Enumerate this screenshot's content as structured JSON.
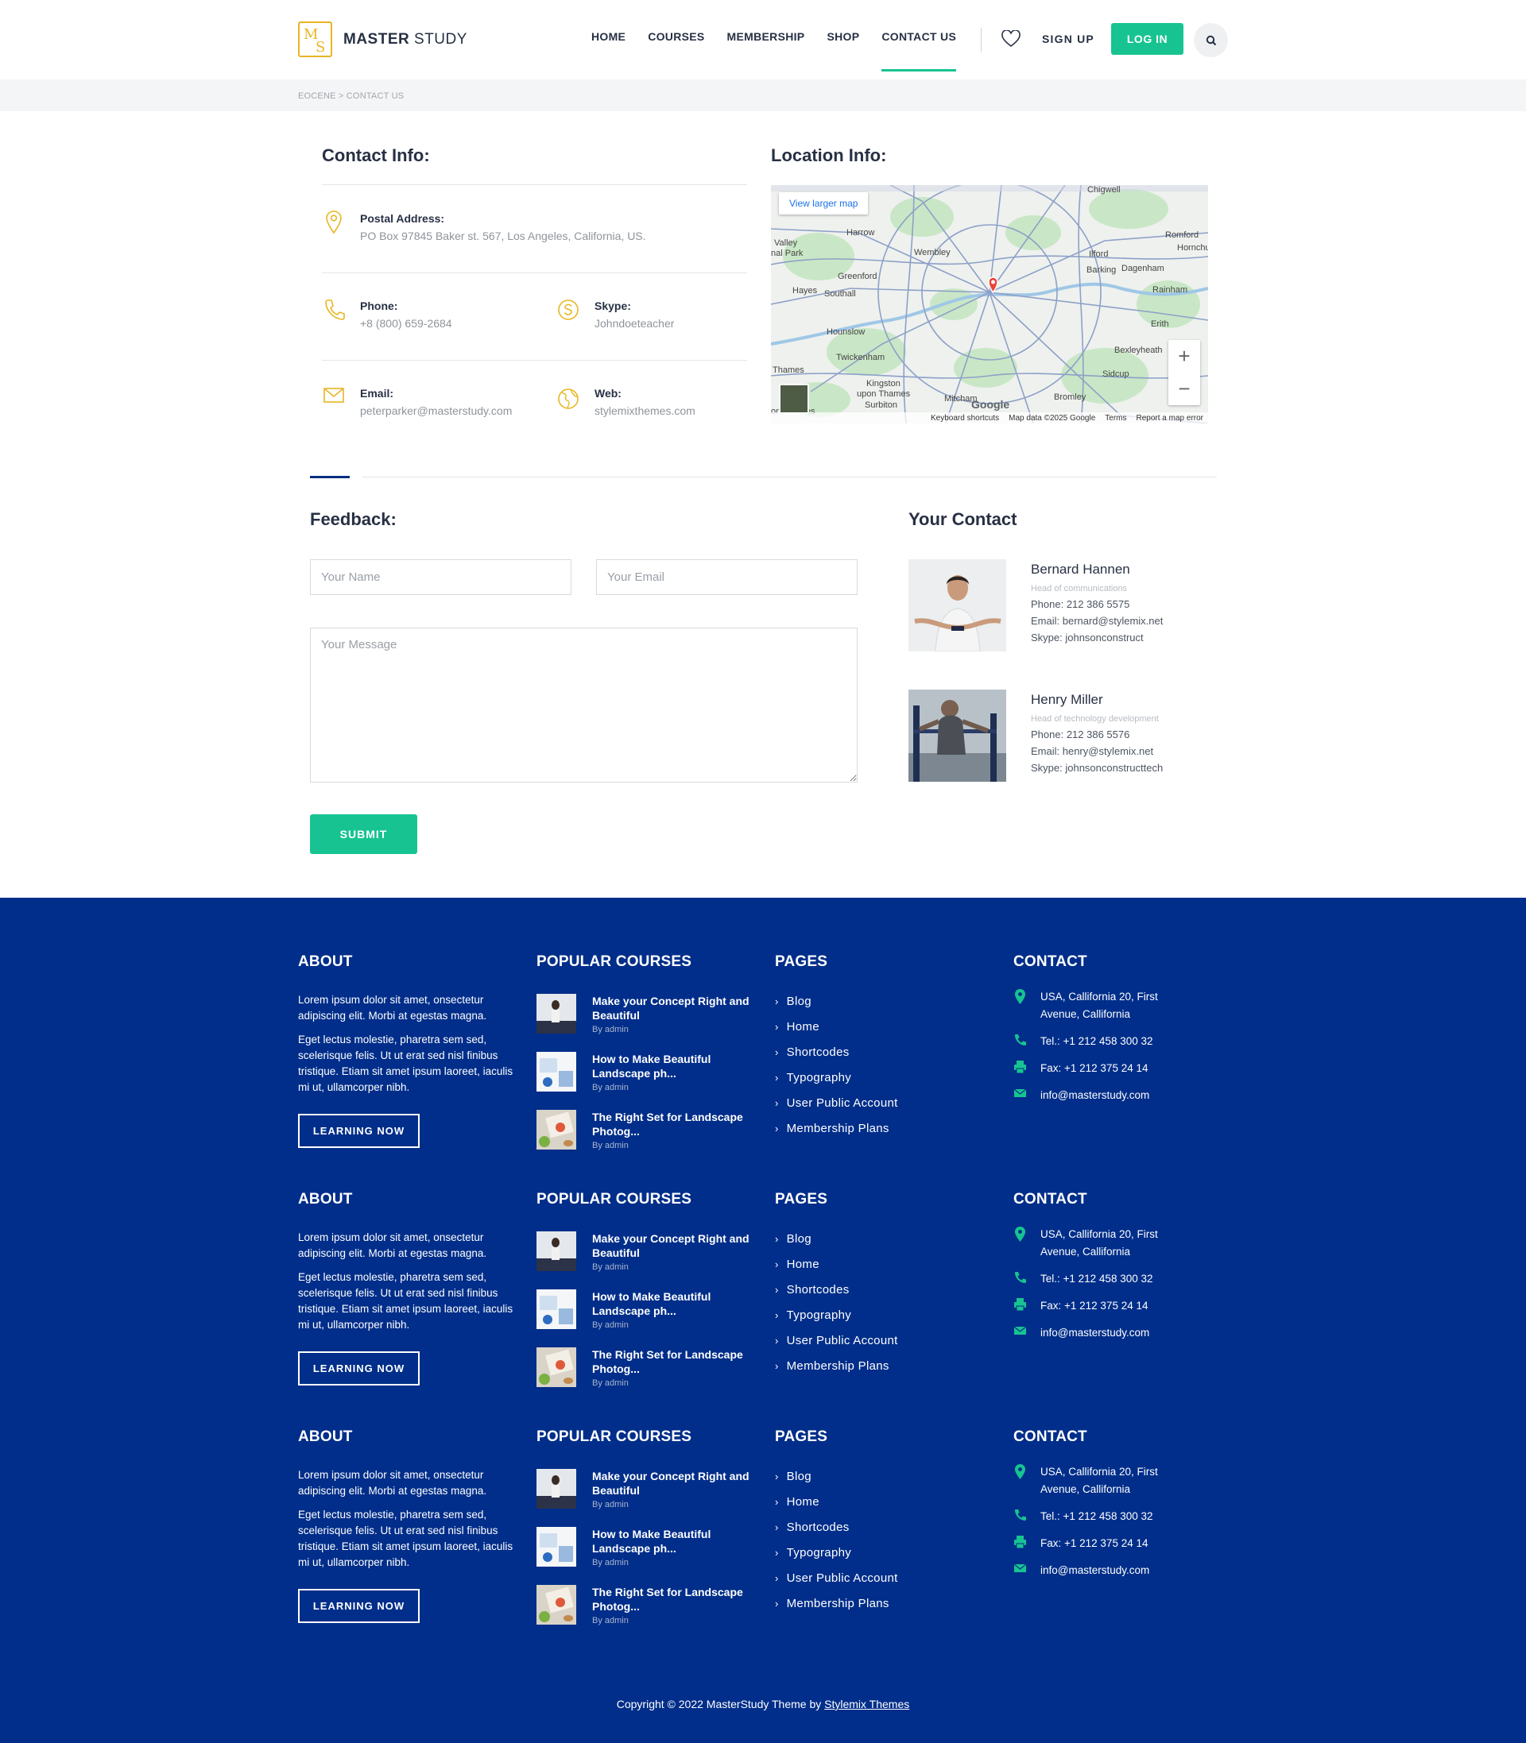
{
  "header": {
    "logo_strong": "MASTER",
    "logo_light": "STUDY",
    "logo_badge_m": "M",
    "logo_badge_s": "S",
    "nav": [
      "HOME",
      "COURSES",
      "MEMBERSHIP",
      "SHOP",
      "CONTACT US"
    ],
    "active_nav": "CONTACT US",
    "signup": "SIGN UP",
    "login": "LOG IN"
  },
  "breadcrumb": "EOCENE > CONTACT US",
  "contact_info": {
    "title": "Contact Info:",
    "postal_label": "Postal Address:",
    "postal_value": "PO Box 97845 Baker st. 567, Los Angeles, California, US.",
    "phone_label": "Phone:",
    "phone_value": "+8 (800) 659-2684",
    "skype_label": "Skype:",
    "skype_value": "Johndoeteacher",
    "email_label": "Email:",
    "email_value": "peterparker@masterstudy.com",
    "web_label": "Web:",
    "web_value": "stylemixthemes.com"
  },
  "location": {
    "title": "Location Info:",
    "view_larger": "View larger map",
    "map_footer": [
      "Keyboard shortcuts",
      "Map data ©2025 Google",
      "Terms",
      "Report a map error"
    ],
    "google": "Google",
    "places": [
      "Chigwell",
      "Harrow",
      "Romford",
      "Wembley",
      "Hornchurch",
      "Ilford",
      "Greenford",
      "Barking",
      "Dagenham",
      "Hayes",
      "Southall",
      "Rainham",
      "Hounslow",
      "Erith",
      "Twickenham",
      "Bexleyheath",
      "Sidcup",
      "Kingston upon Thames",
      "Surbiton",
      "Mitcham",
      "Bromley",
      "Thames",
      "Valley",
      "nal Park",
      "on-Thames"
    ]
  },
  "feedback": {
    "title": "Feedback:",
    "name_placeholder": "Your Name",
    "email_placeholder": "Your Email",
    "message_placeholder": "Your Message",
    "submit": "SUBMIT"
  },
  "your_contact": {
    "title": "Your Contact",
    "people": [
      {
        "name": "Bernard Hannen",
        "role": "Head of communications",
        "phone": "Phone: 212 386 5575",
        "email": "Email: bernard@stylemix.net",
        "skype": "Skype: johnsonconstruct"
      },
      {
        "name": "Henry Miller",
        "role": "Head of technology development",
        "phone": "Phone: 212 386 5576",
        "email": "Email: henry@stylemix.net",
        "skype": "Skype: johnsonconstructtech"
      }
    ]
  },
  "footer": {
    "about_title": "ABOUT",
    "about_p1": "Lorem ipsum dolor sit amet, onsectetur adipiscing elit. Morbi at egestas magna.",
    "about_p2": "Eget lectus molestie, pharetra sem sed, scelerisque felis. Ut ut erat sed nisl finibus tristique. Etiam sit amet ipsum laoreet, iaculis mi ut, ullamcorper nibh.",
    "learn_btn": "LEARNING NOW",
    "courses_title": "POPULAR COURSES",
    "courses": [
      {
        "title": "Make your Concept Right and Beautiful",
        "by": "By admin"
      },
      {
        "title": "How to Make Beautiful Landscape ph...",
        "by": "By admin"
      },
      {
        "title": "The Right Set for Landscape Photog...",
        "by": "By admin"
      }
    ],
    "pages_title": "PAGES",
    "pages": [
      "Blog",
      "Home",
      "Shortcodes",
      "Typography",
      "User Public Account",
      "Membership Plans"
    ],
    "contact_title": "CONTACT",
    "address": "USA, Callifornia 20, First Avenue, Callifornia",
    "tel": "Tel.: +1 212 458 300 32",
    "fax": "Fax: +1 212 375 24 14",
    "email": "info@masterstudy.com",
    "copyright_prefix": "Copyright © 2022 MasterStudy Theme by ",
    "copyright_link": "Stylemix Themes"
  },
  "colors": {
    "accent": "#17c491",
    "footer_bg": "#002e8a",
    "icon_gold": "#e8b624"
  }
}
